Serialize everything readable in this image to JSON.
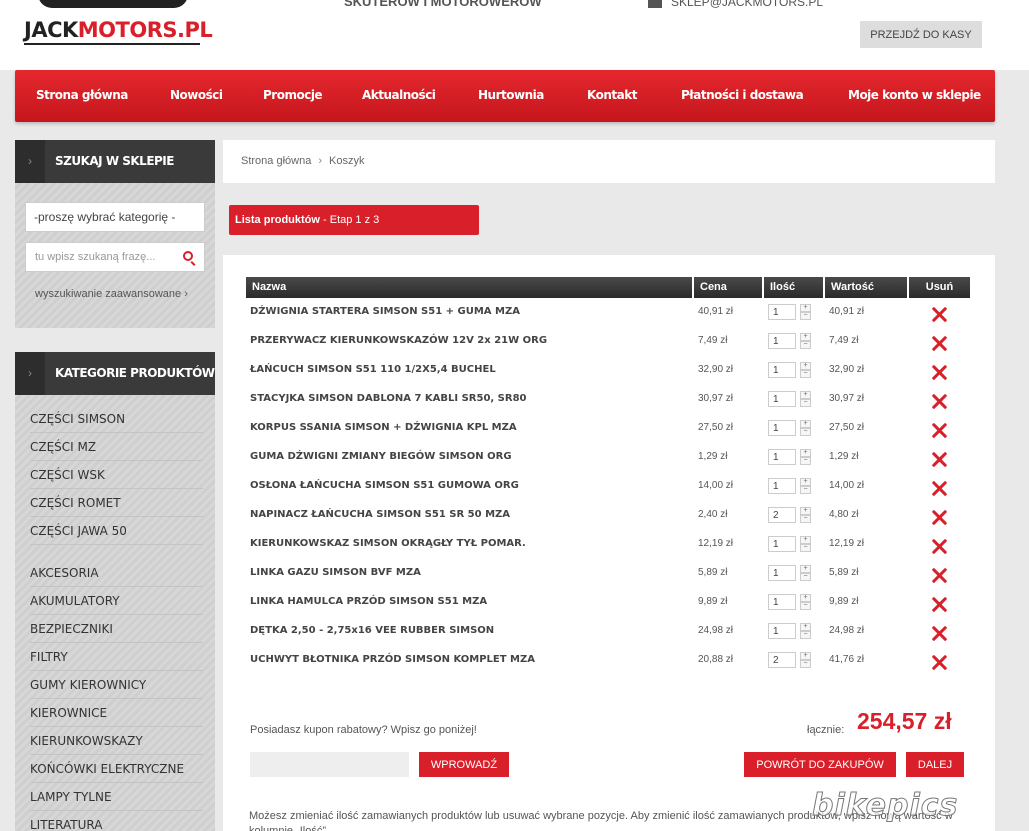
{
  "header": {
    "logo": {
      "part1": "JACK",
      "part2": "MOTORS.PL"
    },
    "tagline": "SKUTERÓW I MOTOROWERÓW",
    "email": "SKLEP@JACKMOTORS.PL",
    "checkout_label": "PRZEJDŹ DO KASY"
  },
  "nav": [
    "Strona główna",
    "Nowości",
    "Promocje",
    "Aktualności",
    "Hurtownia",
    "Kontakt",
    "Płatności i dostawa",
    "Moje konto w sklepie"
  ],
  "sidebar": {
    "search": {
      "title": "SZUKAJ W SKLEPIE",
      "category_select": "-proszę wybrać kategorię -",
      "input_placeholder": "tu wpisz szukaną frazę...",
      "advanced_link": "wyszukiwanie zaawansowane ›"
    },
    "categories": {
      "title": "KATEGORIE PRODUKTÓW",
      "items": [
        "CZĘŚCI SIMSON",
        "CZĘŚCI MZ",
        "CZĘŚCI WSK",
        "CZĘŚCI ROMET",
        "CZĘŚCI JAWA 50",
        "AKCESORIA",
        "AKUMULATORY",
        "BEZPIECZNIKI",
        "FILTRY",
        "GUMY KIEROWNICY",
        "KIEROWNICE",
        "KIERUNKOWSKAZY",
        "KOŃCÓWKI ELEKTRYCZNE",
        "LAMPY TYLNE",
        "LITERATURA"
      ]
    }
  },
  "breadcrumb": {
    "home": "Strona główna",
    "separator": "›",
    "current": "Koszyk"
  },
  "step": {
    "title": "Lista produktów",
    "stage": " - Etap 1 z 3"
  },
  "cart": {
    "columns": {
      "name": "Nazwa",
      "price": "Cena",
      "qty": "Ilość",
      "total": "Wartość",
      "remove": "Usuń"
    },
    "items": [
      {
        "name": "DŹWIGNIA STARTERA SIMSON S51 + GUMA MZA",
        "price": "40,91 zł",
        "qty": "1",
        "total": "40,91 zł"
      },
      {
        "name": "PRZERYWACZ KIERUNKOWSKAZÓW 12V 2x 21W ORG",
        "price": "7,49 zł",
        "qty": "1",
        "total": "7,49 zł"
      },
      {
        "name": "ŁAŃCUCH SIMSON S51 110 1/2X5,4 BUCHEL",
        "price": "32,90 zł",
        "qty": "1",
        "total": "32,90 zł"
      },
      {
        "name": "STACYJKA SIMSON DABLONA 7 KABLI SR50, SR80",
        "price": "30,97 zł",
        "qty": "1",
        "total": "30,97 zł"
      },
      {
        "name": "KORPUS SSANIA SIMSON + DŹWIGNIA KPL MZA",
        "price": "27,50 zł",
        "qty": "1",
        "total": "27,50 zł"
      },
      {
        "name": "GUMA DŹWIGNI ZMIANY BIEGÓW SIMSON ORG",
        "price": "1,29 zł",
        "qty": "1",
        "total": "1,29 zł"
      },
      {
        "name": "OSŁONA ŁAŃCUCHA SIMSON S51 GUMOWA ORG",
        "price": "14,00 zł",
        "qty": "1",
        "total": "14,00 zł"
      },
      {
        "name": "NAPINACZ ŁAŃCUCHA SIMSON S51 SR 50 MZA",
        "price": "2,40 zł",
        "qty": "2",
        "total": "4,80 zł"
      },
      {
        "name": "KIERUNKOWSKAZ SIMSON OKRĄGŁY TYŁ POMAR.",
        "price": "12,19 zł",
        "qty": "1",
        "total": "12,19 zł"
      },
      {
        "name": "LINKA GAZU SIMSON BVF MZA",
        "price": "5,89 zł",
        "qty": "1",
        "total": "5,89 zł"
      },
      {
        "name": "LINKA HAMULCA PRZÓD SIMSON S51 MZA",
        "price": "9,89 zł",
        "qty": "1",
        "total": "9,89 zł"
      },
      {
        "name": "DĘTKA 2,50 - 2,75x16 VEE RUBBER SIMSON",
        "price": "24,98 zł",
        "qty": "1",
        "total": "24,98 zł"
      },
      {
        "name": "UCHWYT BŁOTNIKA PRZÓD SIMSON KOMPLET MZA",
        "price": "20,88 zł",
        "qty": "2",
        "total": "41,76 zł"
      }
    ],
    "qty_plus": "+",
    "qty_minus": "−",
    "coupon_question": "Posiadasz kupon rabatowy? Wpisz go poniżej!",
    "coupon_button": "WPROWADŹ",
    "sum_label": "łącznie:",
    "sum_value": "254,57 zł",
    "back_button": "POWRÓT DO ZAKUPÓW",
    "next_button": "DALEJ",
    "note": "Możesz zmieniać ilość zamawianych produktów lub usuwać wybrane pozycje. Aby zmienić ilość zamawianych produktów, wpisz nową wartość w kolumnie „Ilość”"
  },
  "watermark": "bikepics"
}
